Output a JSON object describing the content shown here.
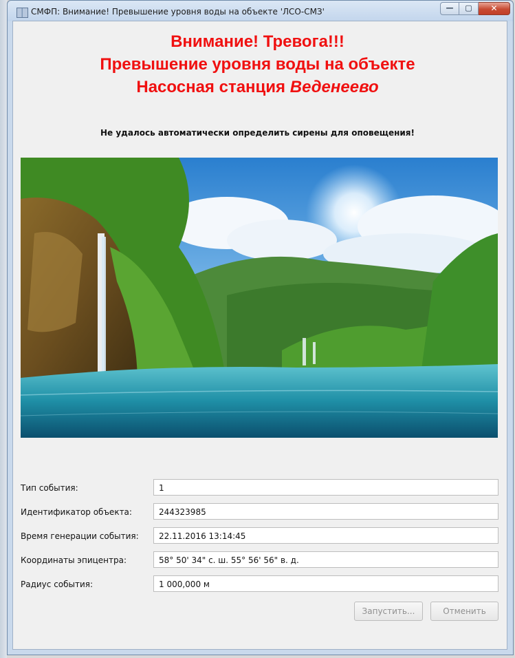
{
  "window": {
    "title": "СМФП: Внимание! Превышение уровня воды на объекте 'ЛСО-СМЗ'",
    "controls": {
      "minimize": "—",
      "maximize": "▢",
      "close": "✕"
    },
    "icon": "app-window-icon"
  },
  "alert": {
    "line1": "Внимание! Тревога!!!",
    "line2": "Превышение уровня воды на объекте",
    "line3_prefix": "Насосная станция",
    "line3_station": "Веденеево",
    "sirens_message": "Не удалось автоматически определить сирены для оповещения!",
    "color": "#f01010"
  },
  "image": {
    "description_icon": "landscape-waterfall-image"
  },
  "form": {
    "event_type_label": "Тип события:",
    "event_type_value": "1",
    "object_id_label": "Идентификатор объекта:",
    "object_id_value": "244323985",
    "generation_time_label": "Время генерации события:",
    "generation_time_value": "22.11.2016 13:14:45",
    "epicenter_label": "Координаты эпицентра:",
    "epicenter_value": "58° 50' 34\" с. ш. 55° 56' 56\" в. д.",
    "radius_label": "Радиус события:",
    "radius_value": "1 000,000 м"
  },
  "buttons": {
    "start": "Запустить...",
    "cancel": "Отменить"
  }
}
